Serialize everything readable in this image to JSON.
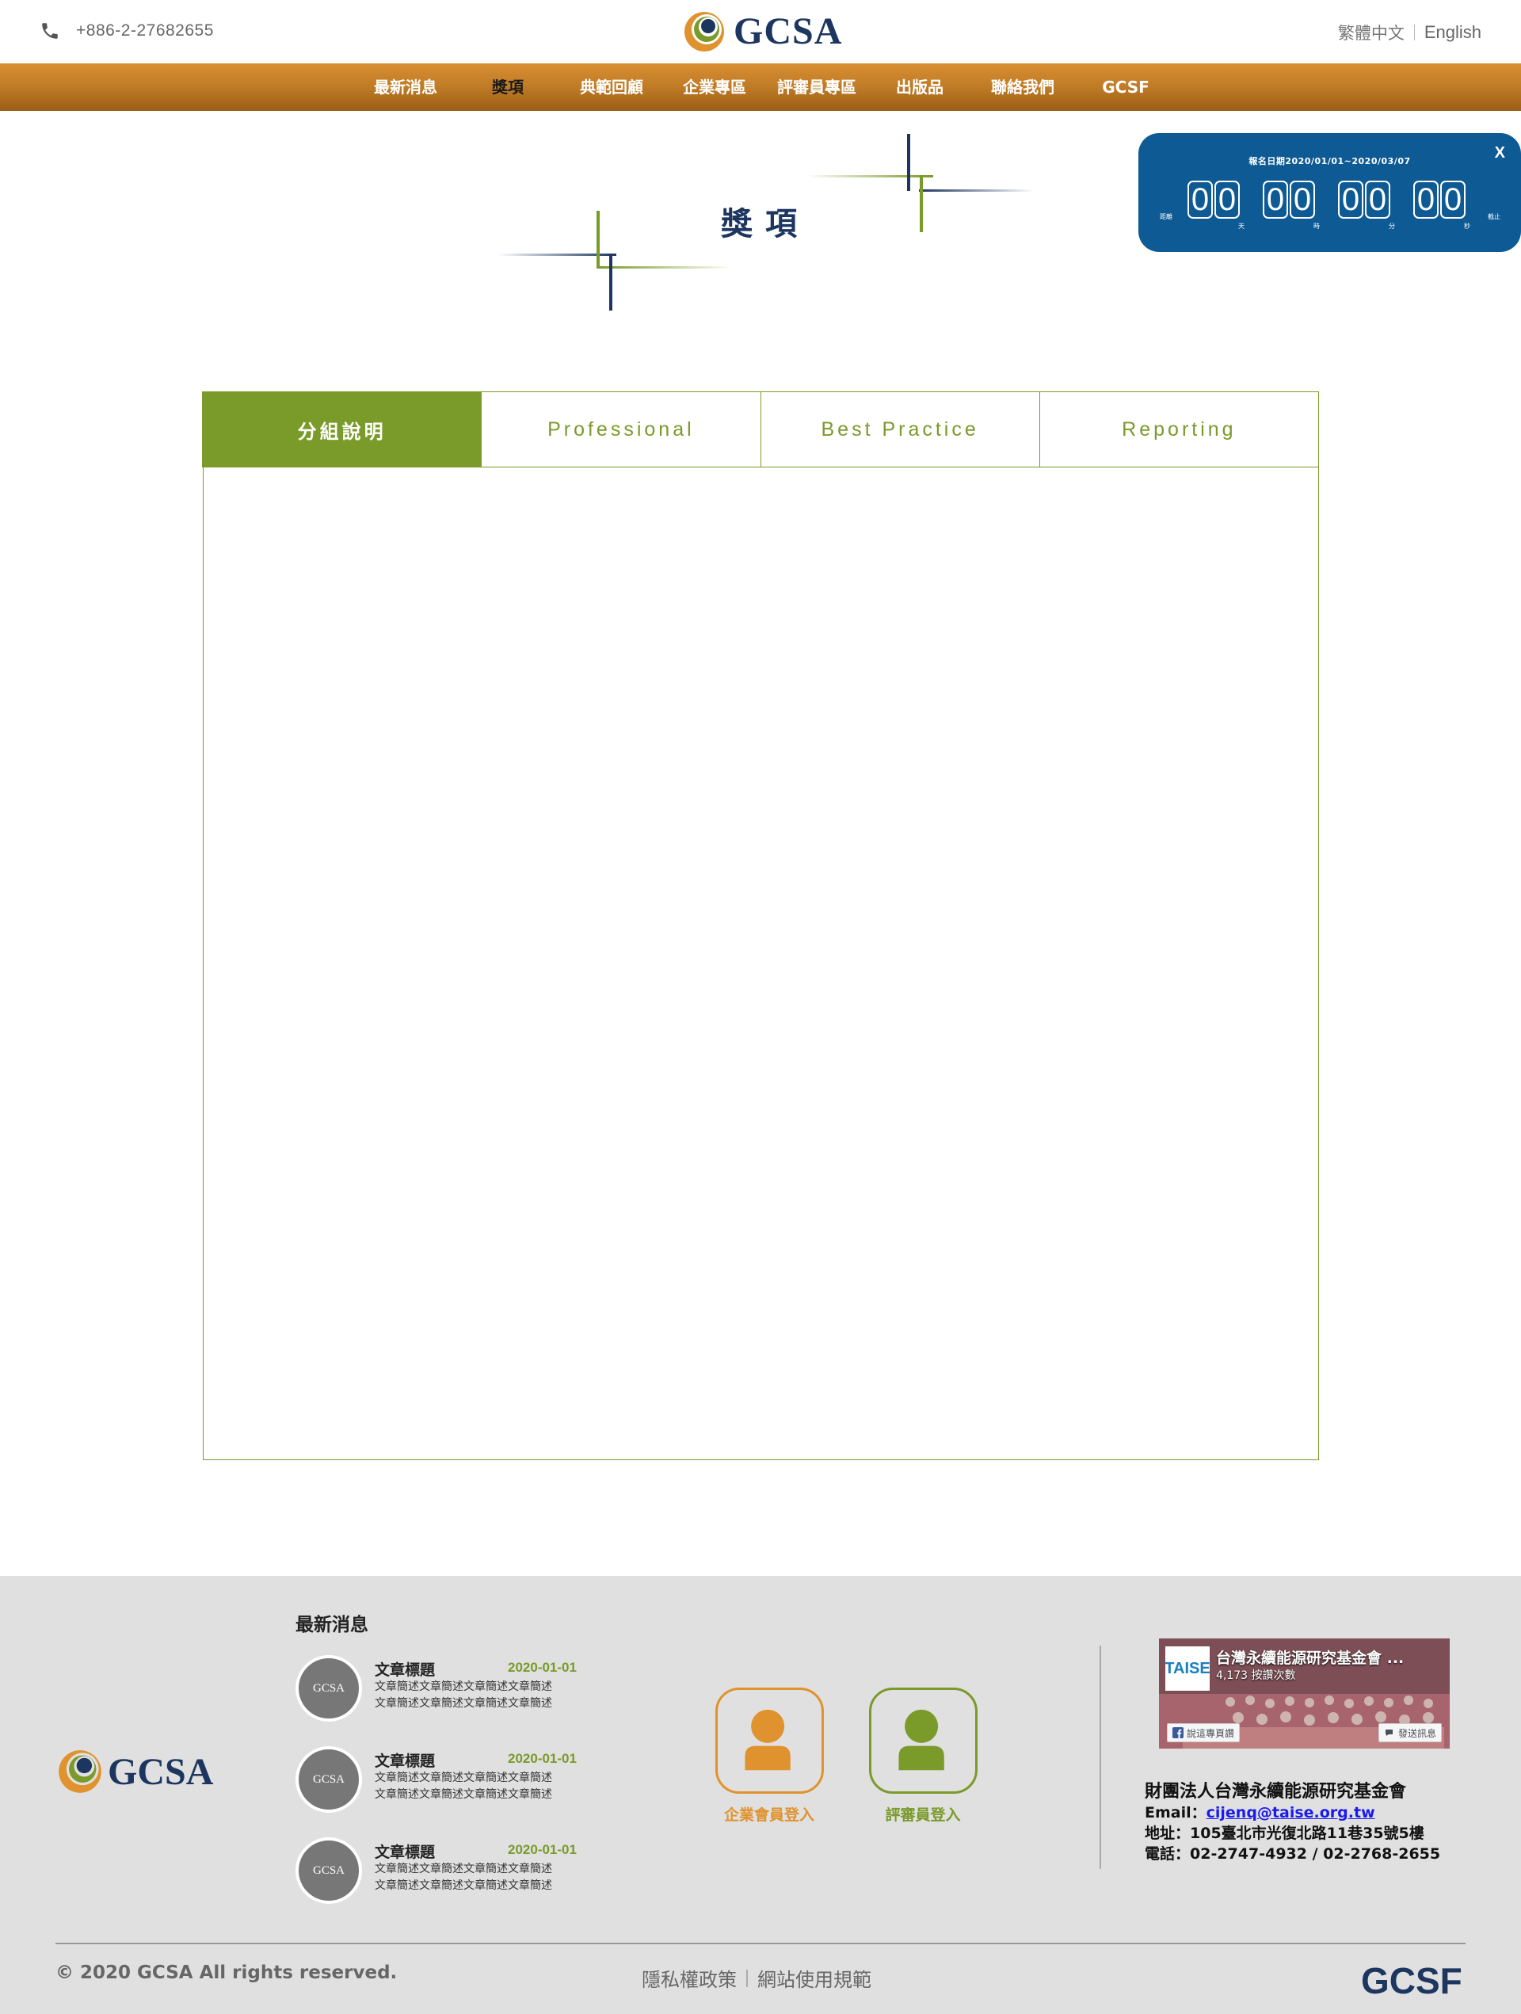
{
  "header": {
    "phone": "+886-2-27682655",
    "logo_text": "GCSA",
    "lang_zh": "繁體中文",
    "lang_en": "English"
  },
  "nav": {
    "items": [
      {
        "label": "最新消息"
      },
      {
        "label": "獎項",
        "active": true
      },
      {
        "label": "典範回顧"
      },
      {
        "label": "企業專區"
      },
      {
        "label": "評審員專區"
      },
      {
        "label": "出版品"
      },
      {
        "label": "聯絡我們"
      },
      {
        "label": "GCSF"
      }
    ]
  },
  "countdown": {
    "close": "X",
    "title": "報名日期2020/01/01~2020/03/07",
    "prefix": "距離",
    "suffix": "截止",
    "digits": [
      "0",
      "0",
      "0",
      "0",
      "0",
      "0",
      "0",
      "0"
    ],
    "units": [
      "天",
      "時",
      "分",
      "秒"
    ]
  },
  "page": {
    "title": "獎項"
  },
  "tabs": [
    {
      "label": "分組說明",
      "active": true
    },
    {
      "label": "Professional"
    },
    {
      "label": "Best Practice"
    },
    {
      "label": "Reporting"
    }
  ],
  "footer": {
    "logo_text": "GCSA",
    "news_heading": "最新消息",
    "news": [
      {
        "avatar": "GCSA",
        "title": "文章標題",
        "date": "2020-01-01",
        "desc1": "文章簡述文章簡述文章簡述文章簡述",
        "desc2": "文章簡述文章簡述文章簡述文章簡述"
      },
      {
        "avatar": "GCSA",
        "title": "文章標題",
        "date": "2020-01-01",
        "desc1": "文章簡述文章簡述文章簡述文章簡述",
        "desc2": "文章簡述文章簡述文章簡述文章簡述"
      },
      {
        "avatar": "GCSA",
        "title": "文章標題",
        "date": "2020-01-01",
        "desc1": "文章簡述文章簡述文章簡述文章簡述",
        "desc2": "文章簡述文章簡述文章簡述文章簡述"
      }
    ],
    "corp_login": "企業會員登入",
    "judge_login": "評審員登入",
    "fb": {
      "logo": "TAISE",
      "name": "台灣永續能源研究基金會 ...",
      "likes": "4,173 按讚次數",
      "like_btn": "說這專頁讚",
      "msg_btn": "發送訊息"
    },
    "org": {
      "name": "財團法人台灣永續能源研究基金會",
      "email_label": "Email：",
      "email": "cijenq@taise.org.tw",
      "address": "地址：105臺北市光復北路11巷35號5樓",
      "tel": "電話：02-2747-4932 / 02-2768-2655"
    },
    "copyright": "© 2020 GCSA All rights reserved.",
    "privacy": "隱私權政策",
    "terms": "網站使用規範",
    "gcsf": "GCSF"
  },
  "colors": {
    "navy": "#1d3660",
    "orange": "#c27d27",
    "green": "#7a9a2a",
    "countdown_blue": "#0e5a94",
    "footer_bg": "#e0e0e0"
  }
}
